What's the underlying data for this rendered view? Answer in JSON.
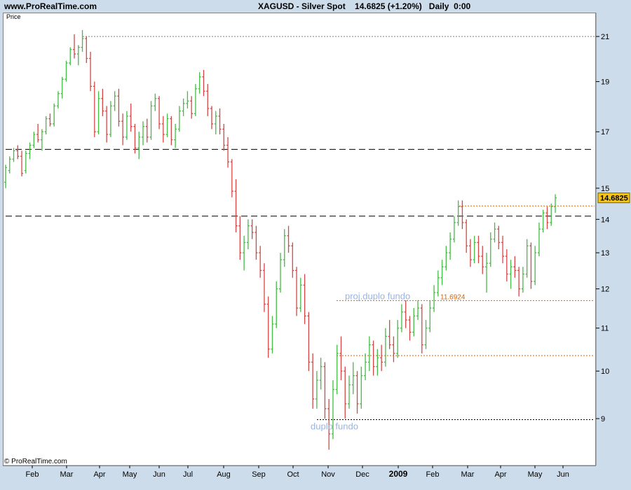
{
  "header": {
    "site": "www.ProRealTime.com",
    "instrument": "XAGUSD - Silver Spot",
    "quote": "14.6825 (+1.20%)",
    "period": "Daily  0:00"
  },
  "panel": {
    "label": "Price",
    "copyright": "© ProRealTime.com"
  },
  "chart_data": {
    "type": "bar",
    "ylabel": "Price",
    "y_ticks": [
      9,
      10,
      11,
      12,
      13,
      14,
      15,
      17,
      19,
      21
    ],
    "ylim": [
      8.2,
      21.8
    ],
    "x_ticks": [
      "Feb",
      "Mar",
      "Apr",
      "May",
      "Jun",
      "Jul",
      "Aug",
      "Sep",
      "Oct",
      "Nov",
      "Dec",
      "2009",
      "Feb",
      "Mar",
      "Apr",
      "May",
      "Jun"
    ],
    "current_price": "14.6825",
    "series": [
      {
        "values": [
          [
            15.2,
            15.8,
            15.0,
            15.7
          ],
          [
            15.6,
            16.1,
            15.5,
            16.0
          ],
          [
            16.0,
            16.4,
            15.9,
            16.3
          ],
          [
            16.3,
            16.5,
            16.0,
            16.1
          ],
          [
            16.1,
            16.3,
            15.4,
            15.5
          ],
          [
            15.6,
            16.3,
            15.5,
            16.2
          ],
          [
            16.2,
            16.6,
            16.0,
            16.5
          ],
          [
            16.5,
            17.0,
            16.4,
            16.9
          ],
          [
            16.9,
            17.3,
            16.6,
            16.7
          ],
          [
            16.7,
            17.1,
            16.3,
            17.0
          ],
          [
            17.0,
            17.6,
            16.9,
            17.5
          ],
          [
            17.5,
            17.7,
            17.2,
            17.3
          ],
          [
            17.3,
            18.1,
            17.2,
            18.0
          ],
          [
            18.0,
            18.6,
            17.9,
            18.5
          ],
          [
            18.5,
            19.2,
            18.3,
            19.1
          ],
          [
            19.1,
            19.9,
            19.0,
            19.8
          ],
          [
            19.8,
            20.5,
            19.7,
            20.4
          ],
          [
            20.4,
            21.1,
            20.0,
            20.2
          ],
          [
            20.2,
            20.6,
            19.7,
            20.5
          ],
          [
            20.5,
            21.3,
            20.3,
            20.9
          ],
          [
            20.9,
            21.0,
            19.8,
            20.0
          ],
          [
            20.0,
            20.3,
            18.6,
            18.8
          ],
          [
            18.8,
            19.0,
            16.8,
            17.0
          ],
          [
            17.0,
            18.6,
            16.9,
            18.3
          ],
          [
            18.3,
            18.7,
            17.6,
            17.8
          ],
          [
            17.8,
            18.0,
            16.6,
            16.9
          ],
          [
            16.9,
            18.2,
            16.8,
            18.0
          ],
          [
            18.0,
            18.6,
            17.8,
            18.4
          ],
          [
            18.4,
            18.7,
            17.2,
            17.4
          ],
          [
            17.4,
            17.7,
            16.5,
            16.8
          ],
          [
            16.8,
            17.8,
            16.7,
            17.6
          ],
          [
            17.6,
            18.1,
            17.0,
            17.2
          ],
          [
            17.2,
            17.3,
            16.2,
            16.4
          ],
          [
            16.4,
            17.0,
            16.0,
            16.8
          ],
          [
            16.8,
            17.4,
            16.5,
            17.2
          ],
          [
            17.2,
            17.5,
            16.6,
            16.8
          ],
          [
            16.8,
            18.2,
            16.7,
            18.0
          ],
          [
            18.0,
            18.5,
            17.8,
            18.3
          ],
          [
            18.3,
            18.4,
            17.1,
            17.3
          ],
          [
            17.3,
            17.6,
            16.6,
            16.9
          ],
          [
            16.9,
            17.7,
            16.8,
            17.5
          ],
          [
            17.5,
            17.6,
            16.5,
            16.7
          ],
          [
            16.7,
            17.3,
            16.4,
            17.1
          ],
          [
            17.1,
            18.0,
            17.0,
            17.8
          ],
          [
            17.8,
            18.3,
            17.6,
            18.1
          ],
          [
            18.1,
            18.6,
            17.9,
            18.2
          ],
          [
            18.2,
            18.4,
            17.5,
            17.7
          ],
          [
            17.7,
            18.9,
            17.6,
            18.7
          ],
          [
            18.7,
            19.4,
            18.5,
            19.2
          ],
          [
            19.2,
            19.5,
            18.4,
            18.6
          ],
          [
            18.6,
            18.9,
            17.6,
            17.9
          ],
          [
            17.9,
            18.0,
            17.1,
            17.3
          ],
          [
            17.3,
            17.8,
            16.9,
            17.6
          ],
          [
            17.6,
            17.9,
            16.9,
            17.1
          ],
          [
            17.1,
            17.3,
            16.3,
            16.5
          ],
          [
            16.5,
            16.8,
            15.7,
            15.9
          ],
          [
            15.9,
            16.0,
            14.7,
            14.9
          ],
          [
            14.9,
            15.3,
            13.6,
            13.8
          ],
          [
            13.8,
            14.1,
            12.8,
            13.0
          ],
          [
            13.0,
            13.5,
            12.5,
            13.3
          ],
          [
            13.3,
            14.0,
            13.1,
            13.8
          ],
          [
            13.8,
            14.0,
            13.4,
            13.6
          ],
          [
            13.6,
            13.8,
            12.8,
            13.0
          ],
          [
            13.0,
            13.2,
            12.3,
            12.5
          ],
          [
            12.5,
            12.7,
            11.4,
            11.6
          ],
          [
            11.6,
            11.8,
            10.3,
            10.5
          ],
          [
            10.5,
            11.3,
            10.4,
            11.1
          ],
          [
            11.1,
            12.2,
            11.0,
            12.0
          ],
          [
            12.0,
            13.0,
            11.9,
            12.8
          ],
          [
            12.8,
            13.7,
            12.6,
            13.5
          ],
          [
            13.5,
            13.8,
            13.0,
            13.2
          ],
          [
            13.2,
            13.3,
            12.3,
            12.5
          ],
          [
            12.5,
            12.6,
            11.3,
            11.5
          ],
          [
            11.5,
            12.3,
            11.4,
            12.1
          ],
          [
            12.1,
            12.4,
            11.1,
            11.3
          ],
          [
            11.3,
            11.4,
            10.0,
            10.2
          ],
          [
            10.2,
            10.4,
            9.2,
            9.4
          ],
          [
            9.4,
            10.0,
            9.2,
            9.8
          ],
          [
            9.8,
            10.3,
            9.6,
            10.1
          ],
          [
            10.1,
            10.2,
            9.0,
            9.2
          ],
          [
            9.2,
            9.4,
            8.4,
            8.7
          ],
          [
            8.7,
            9.8,
            8.6,
            9.6
          ],
          [
            9.6,
            10.6,
            9.5,
            10.4
          ],
          [
            10.4,
            10.8,
            9.8,
            10.0
          ],
          [
            10.0,
            10.1,
            9.0,
            9.3
          ],
          [
            9.3,
            9.9,
            9.2,
            9.7
          ],
          [
            9.7,
            10.2,
            9.5,
            9.9
          ],
          [
            9.9,
            10.0,
            9.1,
            9.3
          ],
          [
            9.3,
            10.1,
            9.2,
            9.9
          ],
          [
            9.9,
            10.4,
            9.8,
            10.2
          ],
          [
            10.2,
            10.8,
            10.0,
            10.6
          ],
          [
            10.6,
            10.7,
            9.9,
            10.1
          ],
          [
            10.1,
            10.5,
            9.9,
            10.3
          ],
          [
            10.3,
            10.6,
            10.0,
            10.2
          ],
          [
            10.2,
            11.0,
            10.1,
            10.8
          ],
          [
            10.8,
            11.2,
            10.5,
            10.6
          ],
          [
            10.6,
            10.8,
            10.2,
            10.4
          ],
          [
            10.4,
            11.2,
            10.3,
            11.0
          ],
          [
            11.0,
            11.6,
            10.9,
            11.4
          ],
          [
            11.4,
            11.7,
            11.0,
            11.2
          ],
          [
            11.2,
            11.3,
            10.7,
            10.9
          ],
          [
            10.9,
            11.5,
            10.8,
            11.3
          ],
          [
            11.3,
            11.7,
            11.2,
            11.5
          ],
          [
            11.5,
            11.6,
            10.4,
            10.6
          ],
          [
            10.6,
            11.2,
            10.5,
            11.0
          ],
          [
            11.0,
            11.7,
            10.9,
            11.5
          ],
          [
            11.5,
            12.1,
            11.4,
            11.9
          ],
          [
            11.9,
            12.5,
            11.8,
            12.3
          ],
          [
            12.3,
            12.8,
            12.1,
            12.6
          ],
          [
            12.6,
            13.2,
            12.5,
            13.0
          ],
          [
            13.0,
            13.6,
            12.8,
            13.4
          ],
          [
            13.4,
            14.1,
            13.3,
            13.9
          ],
          [
            13.9,
            14.6,
            13.8,
            14.4
          ],
          [
            14.4,
            14.6,
            13.7,
            13.9
          ],
          [
            13.9,
            14.0,
            13.0,
            13.2
          ],
          [
            13.2,
            13.4,
            12.6,
            12.8
          ],
          [
            12.8,
            13.5,
            12.7,
            13.3
          ],
          [
            13.3,
            13.5,
            12.7,
            12.9
          ],
          [
            12.9,
            13.2,
            12.4,
            12.6
          ],
          [
            12.6,
            13.0,
            11.9,
            12.7
          ],
          [
            12.7,
            13.6,
            12.6,
            13.4
          ],
          [
            13.4,
            13.9,
            13.3,
            13.7
          ],
          [
            13.7,
            13.8,
            13.1,
            13.3
          ],
          [
            13.3,
            13.5,
            12.7,
            12.9
          ],
          [
            12.9,
            13.1,
            12.2,
            12.4
          ],
          [
            12.4,
            12.8,
            12.0,
            12.6
          ],
          [
            12.6,
            12.9,
            12.3,
            12.5
          ],
          [
            12.5,
            12.6,
            11.8,
            12.0
          ],
          [
            12.0,
            12.6,
            11.9,
            12.4
          ],
          [
            12.4,
            13.4,
            12.3,
            13.2
          ],
          [
            13.2,
            13.3,
            12.0,
            12.2
          ],
          [
            12.2,
            13.2,
            12.1,
            13.0
          ],
          [
            13.0,
            13.9,
            12.9,
            13.7
          ],
          [
            13.7,
            14.3,
            13.6,
            14.2
          ],
          [
            14.2,
            14.4,
            13.7,
            13.9
          ],
          [
            13.9,
            14.5,
            13.8,
            14.4
          ],
          [
            14.4,
            14.8,
            14.2,
            14.6825
          ]
        ]
      }
    ],
    "annotations": [
      {
        "label": "proj.duplo fundo",
        "price": 11.6924
      },
      {
        "label": "11.6924",
        "price": 11.6924
      },
      {
        "label": "duplo fundo",
        "price": 8.98
      }
    ],
    "levels": [
      {
        "price": 21.0,
        "style": "dotted",
        "color": "#808080"
      },
      {
        "price": 16.35,
        "style": "dashed",
        "color": "#000000"
      },
      {
        "price": 14.1,
        "style": "dashed",
        "color": "#000000"
      },
      {
        "price": 14.42,
        "style": "dotted",
        "color": "#e06000"
      },
      {
        "price": 11.6924,
        "style": "dotted",
        "color": "#e06000"
      },
      {
        "price": 10.35,
        "style": "dotted",
        "color": "#e06000"
      },
      {
        "price": 8.98,
        "style": "dotted",
        "color": "#000000"
      }
    ],
    "colors": {
      "up": "#44bb44",
      "down": "#d64545",
      "badge": "#f5c518"
    }
  }
}
